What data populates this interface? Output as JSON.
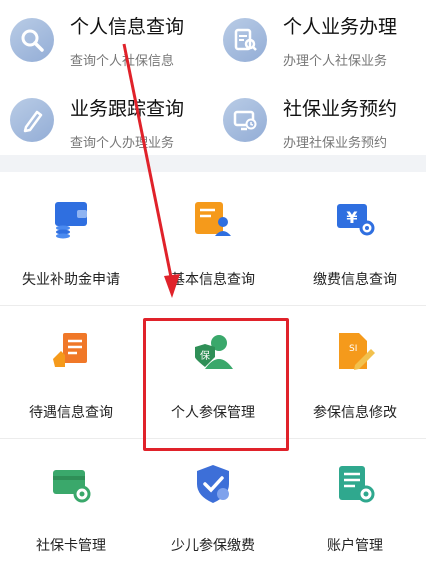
{
  "quick_services": [
    {
      "title": "个人信息查询",
      "subtitle": "查询个人社保信息",
      "icon": "search-icon"
    },
    {
      "title": "个人业务办理",
      "subtitle": "办理个人社保业务",
      "icon": "document-search-icon"
    },
    {
      "title": "业务跟踪查询",
      "subtitle": "查询个人办理业务",
      "icon": "pen-icon"
    },
    {
      "title": "社保业务预约",
      "subtitle": "办理社保业务预约",
      "icon": "monitor-clock-icon"
    }
  ],
  "grid_items": [
    {
      "label": "失业补助金申请",
      "icon": "wallet-coins-icon"
    },
    {
      "label": "基本信息查询",
      "icon": "profile-card-icon"
    },
    {
      "label": "缴费信息查询",
      "icon": "yen-ticket-icon"
    },
    {
      "label": "待遇信息查询",
      "icon": "hand-list-icon"
    },
    {
      "label": "个人参保管理",
      "icon": "insured-person-icon"
    },
    {
      "label": "参保信息修改",
      "icon": "edit-document-icon"
    },
    {
      "label": "社保卡管理",
      "icon": "card-gear-icon"
    },
    {
      "label": "少儿参保缴费",
      "icon": "shield-check-icon"
    },
    {
      "label": "账户管理",
      "icon": "account-list-icon"
    }
  ],
  "colors": {
    "highlight": "#e0222a",
    "blue": "#2f6fe0",
    "orange": "#f59a1b",
    "green": "#3aa86b"
  }
}
